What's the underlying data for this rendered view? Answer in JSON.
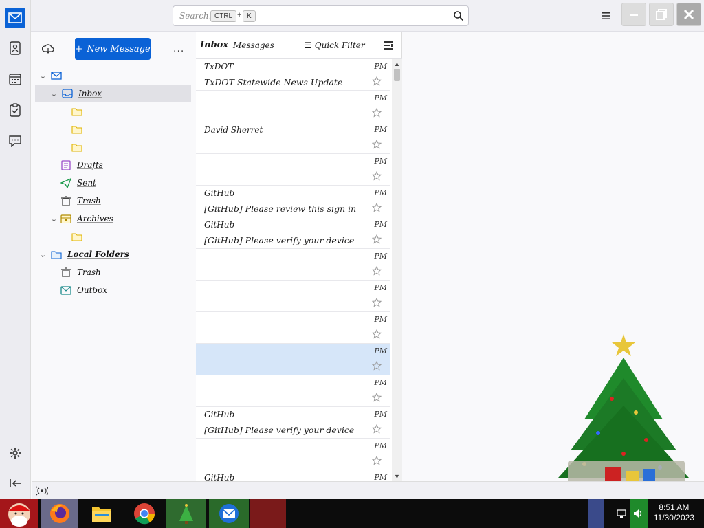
{
  "search": {
    "placeholder": "Search...",
    "key1": "CTRL",
    "separator": "+",
    "key2": "K"
  },
  "spaces": {
    "items": [
      {
        "name": "mail-icon",
        "active": true
      },
      {
        "name": "address-book-icon"
      },
      {
        "name": "calendar-icon"
      },
      {
        "name": "tasks-icon"
      },
      {
        "name": "chat-icon"
      },
      {
        "name": "settings-icon"
      },
      {
        "name": "collapse-icon"
      }
    ]
  },
  "folder_pane": {
    "new_message_label": "New Message",
    "more_label": "...",
    "account": "",
    "folders": [
      {
        "label": "Inbox",
        "level": 1
      },
      {
        "label": "",
        "level": 2
      },
      {
        "label": "",
        "level": 2
      },
      {
        "label": "",
        "level": 2
      },
      {
        "label": "Drafts",
        "level": 1
      },
      {
        "label": "Sent",
        "level": 1
      },
      {
        "label": "Trash",
        "level": 1
      },
      {
        "label": "Archives",
        "level": 1
      },
      {
        "label": "",
        "level": 2
      }
    ],
    "local_folders": {
      "label": "Local Folders",
      "children": [
        {
          "label": "Trash"
        },
        {
          "label": "Outbox"
        }
      ]
    }
  },
  "message_list": {
    "title": "Inbox",
    "count_label": "Messages",
    "quick_filter_label": "Quick Filter",
    "messages": [
      {
        "from": "TxDOT",
        "date": "PM",
        "subject": "TxDOT Statewide News Update",
        "selected": false
      },
      {
        "from": "",
        "date": "PM",
        "subject": "",
        "selected": false
      },
      {
        "from": "David Sherret",
        "date": "PM",
        "subject": "",
        "selected": false
      },
      {
        "from": "",
        "date": "PM",
        "subject": "",
        "selected": false
      },
      {
        "from": "GitHub",
        "date": "PM",
        "subject": "[GitHub] Please review this sign in",
        "selected": false
      },
      {
        "from": "GitHub",
        "date": "PM",
        "subject": "[GitHub] Please verify your device",
        "selected": false
      },
      {
        "from": "",
        "date": "PM",
        "subject": "",
        "selected": false
      },
      {
        "from": "",
        "date": "PM",
        "subject": "",
        "selected": false
      },
      {
        "from": "",
        "date": "PM",
        "subject": "",
        "selected": false
      },
      {
        "from": "",
        "date": "PM",
        "subject": "",
        "selected": true
      },
      {
        "from": "",
        "date": "PM",
        "subject": "",
        "selected": false
      },
      {
        "from": "GitHub",
        "date": "PM",
        "subject": "[GitHub] Please verify your device",
        "selected": false
      },
      {
        "from": "",
        "date": "PM",
        "subject": "",
        "selected": false
      },
      {
        "from": "GitHub",
        "date": "PM",
        "subject": "",
        "selected": false
      }
    ]
  },
  "status_bar": {
    "text": ""
  },
  "taskbar": {
    "time": "8:51 AM",
    "date": "11/30/2023"
  },
  "colors": {
    "accent": "#0a62d6",
    "selected_row": "#d6e6f9",
    "taskbar": "#0c0c0c"
  }
}
